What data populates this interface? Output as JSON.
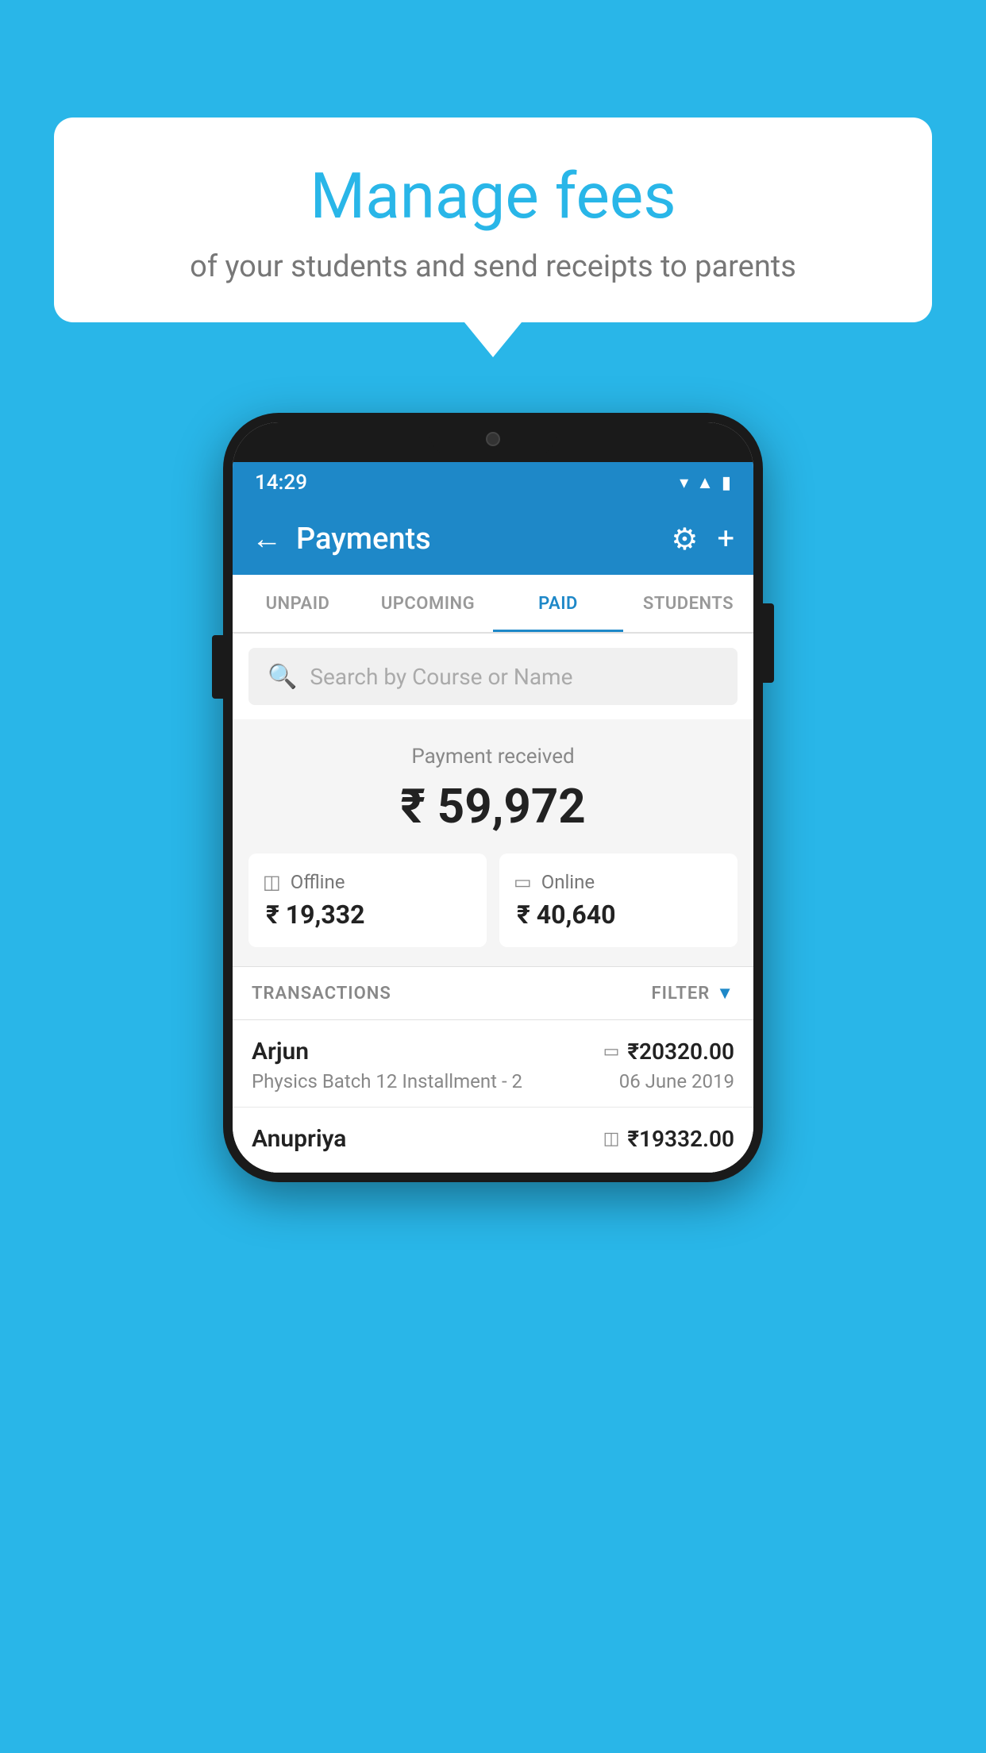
{
  "page": {
    "background_color": "#29b6e8"
  },
  "bubble": {
    "title": "Manage fees",
    "subtitle": "of your students and send receipts to parents"
  },
  "status_bar": {
    "time": "14:29",
    "wifi": "▾",
    "signal": "▲",
    "battery": "▮"
  },
  "app_bar": {
    "title": "Payments",
    "back_label": "←",
    "gear_label": "⚙",
    "plus_label": "+"
  },
  "tabs": [
    {
      "id": "unpaid",
      "label": "UNPAID",
      "active": false
    },
    {
      "id": "upcoming",
      "label": "UPCOMING",
      "active": false
    },
    {
      "id": "paid",
      "label": "PAID",
      "active": true
    },
    {
      "id": "students",
      "label": "STUDENTS",
      "active": false
    }
  ],
  "search": {
    "placeholder": "Search by Course or Name"
  },
  "payment_summary": {
    "received_label": "Payment received",
    "total_amount": "₹ 59,972",
    "offline_label": "Offline",
    "offline_amount": "₹ 19,332",
    "online_label": "Online",
    "online_amount": "₹ 40,640"
  },
  "transactions": {
    "section_label": "TRANSACTIONS",
    "filter_label": "FILTER",
    "rows": [
      {
        "name": "Arjun",
        "description": "Physics Batch 12 Installment - 2",
        "amount": "₹20320.00",
        "date": "06 June 2019",
        "type": "online"
      },
      {
        "name": "Anupriya",
        "description": "",
        "amount": "₹19332.00",
        "date": "",
        "type": "offline"
      }
    ]
  }
}
